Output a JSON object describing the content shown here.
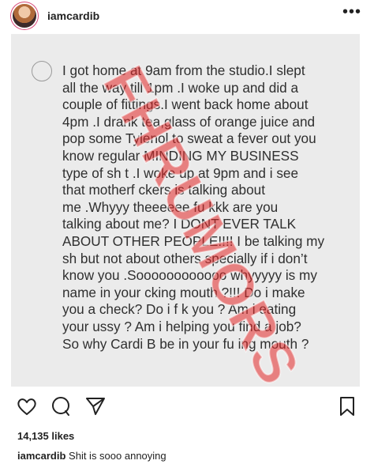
{
  "post": {
    "username": "iamcardib",
    "more_icon": "more-icon",
    "text": "I got home at 9am from the studio.I slept\nall the way till 1pm .I woke up and did a\ncouple of fittings.I went back home about\n4pm .I drank tea,glass of orange juice and\npop some Tylenol to sweat a fever out you\nknow regular MINDING MY BUSINESS\ntype of sh t .I woke up at 9pm and i see\nthat motherf ckers is talking about\nme .Whyyy theeeeee fu  kkk are you\ntalking about me? I DONT EVER TALK\nABOUT OTHER PEOPLE!!!! I be talking my\nsh  but not about others specially if i don’t\nknow you .Soooooooooooo whyyyyy is my\nname in your   cking mouth ?!!! Do i make\nyou a check? Do i f  k you ? Am i eating\nyour  ussy ? Am i helping you find a job?\nSo why Cardi B be in your fu  ing mouth ?",
    "watermark": "FHRUMORS"
  },
  "actions": {
    "like_icon": "heart-icon",
    "comment_icon": "comment-icon",
    "share_icon": "share-icon",
    "save_icon": "bookmark-icon"
  },
  "likes": "14,135 likes",
  "caption": {
    "username": "iamcardib",
    "text": "Shit is sooo annoying"
  }
}
